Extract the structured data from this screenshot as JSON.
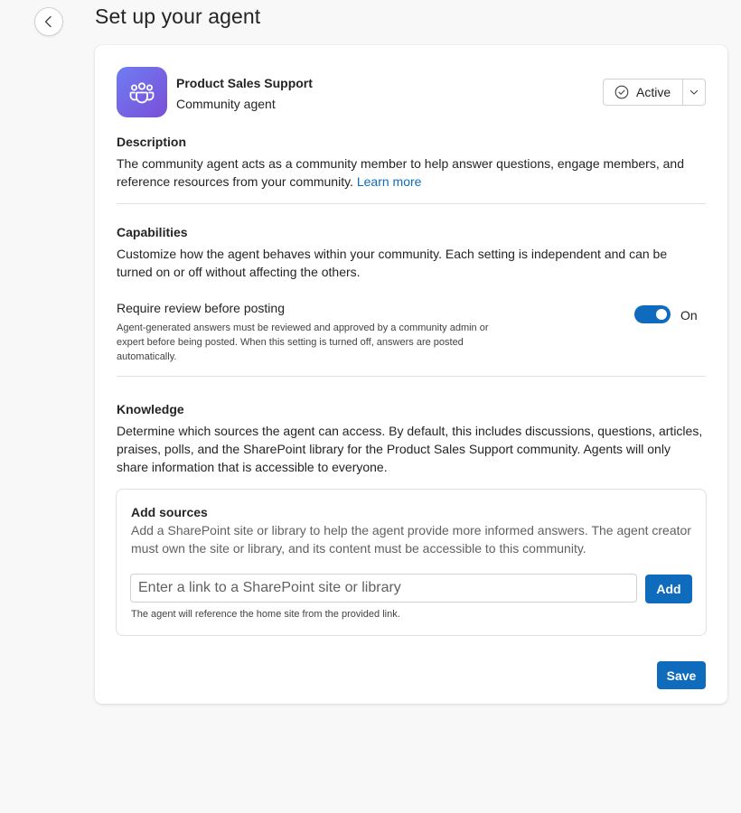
{
  "header": {
    "back_icon": "chevron-left-icon",
    "title": "Set up your agent"
  },
  "agent": {
    "avatar_icon": "people-community-icon",
    "name": "Product Sales Support",
    "type": "Community agent",
    "status": {
      "label": "Active",
      "icon": "checkmark-circle-icon",
      "dropdown_icon": "chevron-down-icon"
    }
  },
  "description": {
    "heading": "Description",
    "text": "The community agent acts as a community member to help answer questions, engage members, and reference resources from your community. ",
    "link_label": "Learn more"
  },
  "capabilities": {
    "heading": "Capabilities",
    "text": "Customize how the agent behaves within your community. Each setting is independent and can be turned on or off without affecting the others.",
    "review_setting": {
      "title": "Require review before posting",
      "description": "Agent-generated answers must be reviewed and approved by a community admin or expert before being posted. When this setting is turned off, answers are posted automatically.",
      "enabled": true,
      "state_label": "On"
    }
  },
  "knowledge": {
    "heading": "Knowledge",
    "text": "Determine which sources the agent can access. By default, this includes discussions, questions, articles, praises, polls, and the SharePoint library for the Product Sales Support community. Agents will only share information that is accessible to everyone.",
    "add_sources": {
      "title": "Add sources",
      "text": "Add a SharePoint site or library to help the agent provide more informed answers. The agent creator must own the site or library, and its content must be accessible to this community.",
      "input_value": "",
      "input_placeholder": "Enter a link to a SharePoint site or library",
      "add_label": "Add",
      "hint": "The agent will reference the home site from the provided link."
    }
  },
  "footer": {
    "save_label": "Save"
  },
  "colors": {
    "accent": "#0f6cbd",
    "avatar_gradient_start": "#6f7cf2",
    "avatar_gradient_end": "#7a4fd8",
    "page_background": "#f8f8f8"
  }
}
